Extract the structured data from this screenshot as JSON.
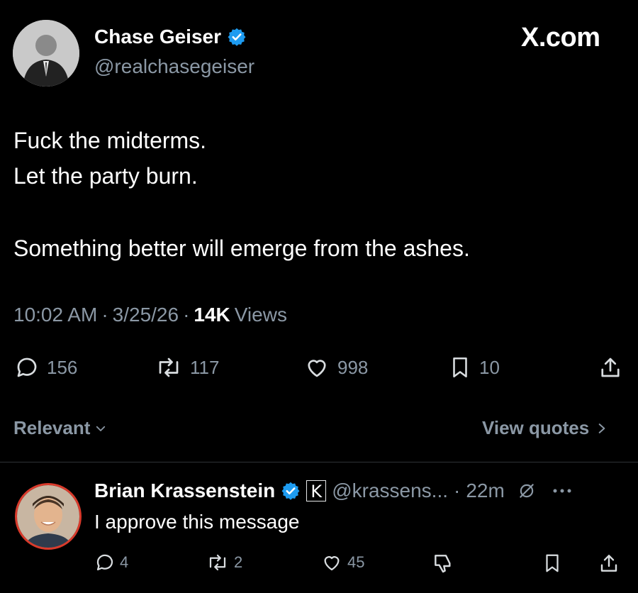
{
  "watermark": "X.com",
  "tweet": {
    "author_name": "Chase Geiser",
    "author_handle": "@realchasegeiser",
    "lines": [
      "Fuck the midterms.",
      "Let the party burn.",
      "Something better will emerge from the ashes."
    ],
    "time": "10:02 AM",
    "sep1": "·",
    "date": "3/25/26",
    "sep2": "·",
    "views_count": "14K",
    "views_label": "Views",
    "actions": {
      "replies": "156",
      "reposts": "117",
      "likes": "998",
      "bookmarks": "10"
    }
  },
  "filter": {
    "sort_label": "Relevant",
    "view_quotes_label": "View quotes"
  },
  "reply": {
    "author_name": "Brian Krassenstein",
    "badge_letter": "K",
    "author_handle": "@krassens...",
    "sep": "·",
    "time_ago": "22m",
    "text": "I approve this message",
    "actions": {
      "replies": "4",
      "reposts": "2",
      "likes": "45"
    }
  },
  "colors": {
    "verified": "#1d9bf0",
    "muted": "#8b98a5",
    "divider": "#2f3336",
    "background": "#000000"
  }
}
